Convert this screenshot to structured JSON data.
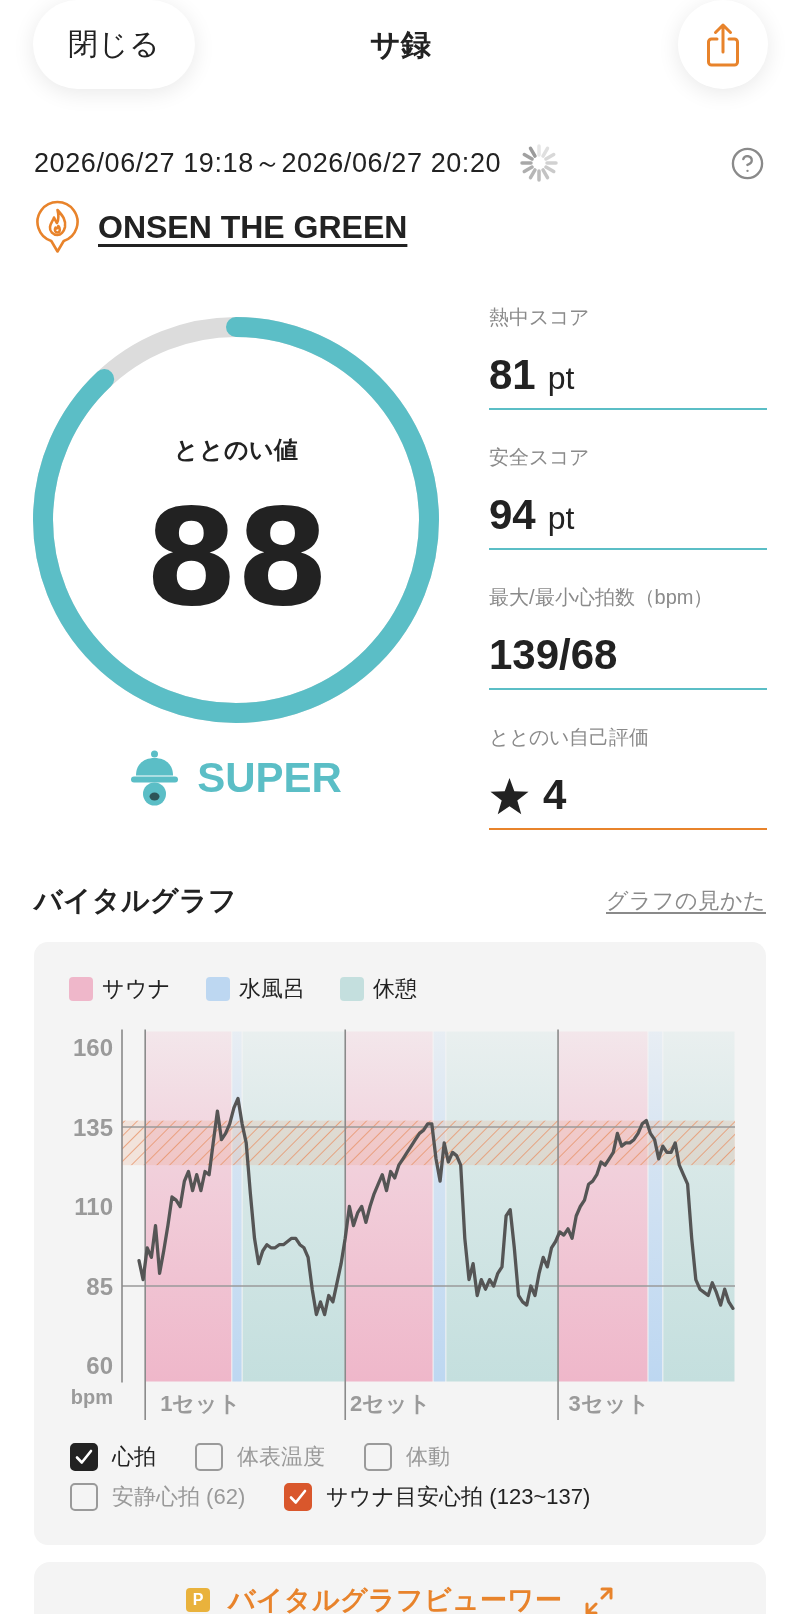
{
  "header": {
    "close_button": "閉じる",
    "title": "サ録"
  },
  "session": {
    "datetime": "2026/06/27 19:18～2026/06/27 20:20",
    "place": "ONSEN THE GREEN"
  },
  "totonoi": {
    "label": "ととのい値",
    "value": "88",
    "level": 0.88,
    "rank": "SUPER"
  },
  "scores": [
    {
      "kind": "score",
      "label": "熱中スコア",
      "value": "81",
      "unit": "pt"
    },
    {
      "kind": "score",
      "label": "安全スコア",
      "value": "94",
      "unit": "pt"
    },
    {
      "kind": "score",
      "label": "最大/最小心拍数（bpm）",
      "value": "139/68"
    },
    {
      "kind": "rating",
      "label": "ととのい自己評価",
      "value": "4"
    }
  ],
  "vital_graph": {
    "title": "バイタルグラフ",
    "help_link": "グラフの見かた",
    "legend": [
      {
        "label": "サウナ",
        "color": "#efb7ca"
      },
      {
        "label": "水風呂",
        "color": "#bdd7f1"
      },
      {
        "label": "休憩",
        "color": "#c4dfde"
      }
    ],
    "chart_data": {
      "type": "line",
      "ylabel": "bpm",
      "ylim": [
        60,
        160
      ],
      "yticks": [
        60,
        85,
        110,
        135,
        160
      ],
      "categories": [
        null,
        null,
        null,
        null,
        null,
        null,
        null,
        null,
        null,
        null,
        null,
        null,
        null,
        null,
        null,
        "1セット",
        null,
        null,
        null,
        null,
        null,
        null,
        null,
        null,
        null,
        null,
        null,
        null,
        null,
        null,
        null,
        null,
        null,
        null,
        null,
        null,
        null,
        null,
        null,
        null,
        null,
        null,
        null,
        null,
        null,
        null,
        null,
        null,
        null,
        null,
        null,
        null,
        null,
        null,
        null,
        null,
        null,
        null,
        null,
        null,
        null,
        "2セット",
        null,
        null,
        null,
        null,
        null,
        null,
        null,
        null,
        null,
        null,
        null,
        null,
        null,
        null,
        null,
        null,
        null,
        null,
        null,
        null,
        null,
        null,
        null,
        null,
        null,
        null,
        null,
        null,
        null,
        null,
        null,
        null,
        null,
        null,
        null,
        null,
        null,
        null,
        null,
        null,
        null,
        null,
        null,
        null,
        null,
        null,
        null,
        null,
        null,
        null,
        null,
        null,
        "3セット",
        null,
        null,
        null,
        null,
        null,
        null,
        null,
        null,
        null,
        null,
        null,
        null,
        null,
        null,
        null,
        null,
        null,
        null,
        null,
        null,
        null,
        null,
        null,
        null,
        null,
        null,
        null,
        null,
        null,
        null
      ],
      "series": [
        {
          "color": "#555555",
          "values": [
            93,
            87,
            97,
            94,
            104,
            89,
            96,
            104,
            113,
            112,
            110,
            118,
            121,
            115,
            120,
            115,
            121,
            120,
            130,
            140,
            131,
            133,
            136,
            141,
            144,
            136,
            130,
            114,
            100,
            92,
            96,
            98,
            97,
            97,
            98,
            98,
            99,
            100,
            100,
            98,
            97,
            94,
            84,
            76,
            80,
            76,
            82,
            80,
            86,
            92,
            100,
            110,
            104,
            108,
            110,
            105,
            110,
            114,
            117,
            120,
            115,
            121,
            119,
            123,
            125,
            127,
            129,
            131,
            133,
            134,
            136,
            136,
            125,
            118,
            130,
            124,
            127,
            126,
            123,
            100,
            87,
            92,
            82,
            87,
            84,
            87,
            85,
            89,
            91,
            107,
            109,
            97,
            82,
            80,
            79,
            85,
            82,
            89,
            94,
            91,
            97,
            99,
            102,
            101,
            103,
            100,
            107,
            110,
            112,
            117,
            118,
            120,
            124,
            123,
            125,
            127,
            133,
            129,
            130,
            130,
            131,
            133,
            136,
            137,
            133,
            131,
            125,
            129,
            127,
            127,
            130,
            123,
            120,
            117,
            100,
            87,
            84,
            83,
            82,
            86,
            83,
            79,
            84,
            80,
            78
          ]
        }
      ],
      "bands": [
        {
          "axis": "y",
          "from": 123,
          "to": 137,
          "color": "#e8946a"
        }
      ],
      "ref_lines": [
        {
          "axis": "y",
          "value": 135
        },
        {
          "axis": "y",
          "value": 85
        }
      ]
    },
    "toggle_rows": [
      {
        "items": [
          {
            "label": "心拍",
            "checked": true,
            "color": "#222222"
          },
          {
            "label": "体表温度",
            "checked": false
          },
          {
            "label": "体動",
            "checked": false
          }
        ]
      },
      {
        "items": [
          {
            "label": "安静心拍 (62)",
            "checked": false
          },
          {
            "label": "サウナ目安心拍 (123~137)",
            "checked": true,
            "color": "#d9572c"
          }
        ]
      }
    ]
  },
  "viewer_button": {
    "badge": "P",
    "label": "バイタルグラフビューワー"
  }
}
